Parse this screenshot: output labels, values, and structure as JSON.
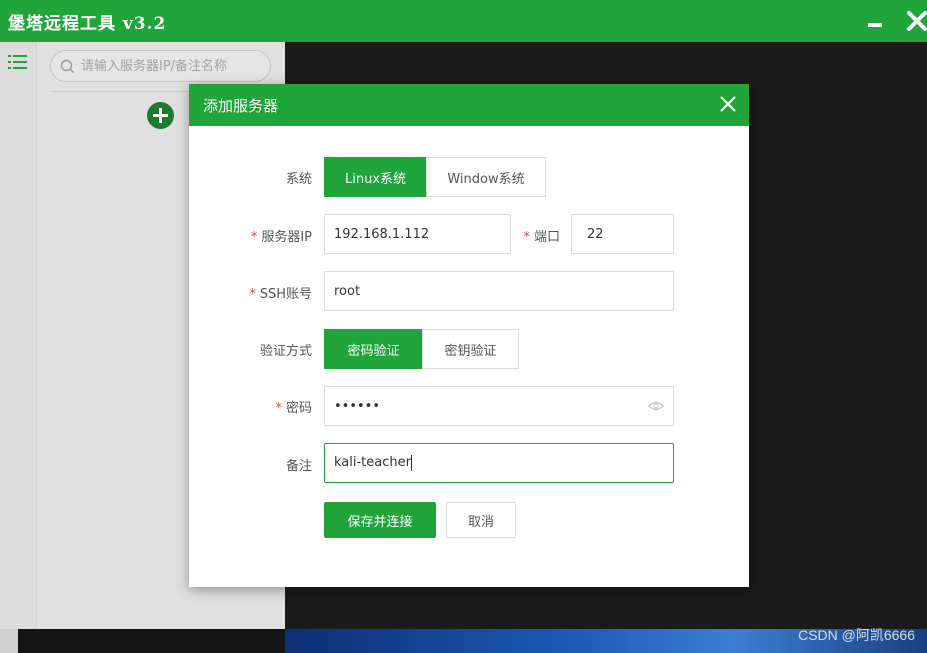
{
  "app": {
    "title": "堡塔远程工具  v3.2",
    "colors": {
      "brand": "#20a53a",
      "dark_bg": "#1b1b1b",
      "panel_bg": "#e0e0e0"
    },
    "icons": {
      "minimize": "minimize-icon",
      "close": "close-icon",
      "list": "list-icon",
      "add": "plus-icon"
    }
  },
  "sidebar": {
    "search": {
      "placeholder": "请输入服务器IP/备注名称"
    }
  },
  "dialog": {
    "title": "添加服务器",
    "system": {
      "label": "系统",
      "options": [
        "Linux系统",
        "Window系统"
      ],
      "selected": "Linux系统"
    },
    "server_ip": {
      "label": "服务器IP",
      "value": "192.168.1.112"
    },
    "port": {
      "label": "端口",
      "value": "22"
    },
    "ssh_account": {
      "label": "SSH账号",
      "value": "root"
    },
    "auth_method": {
      "label": "验证方式",
      "options": [
        "密码验证",
        "密钥验证"
      ],
      "selected": "密码验证"
    },
    "password": {
      "label": "密码",
      "value": "••••••"
    },
    "remark": {
      "label": "备注",
      "value": "kali-teacher"
    },
    "buttons": {
      "save": "保存并连接",
      "cancel": "取消"
    }
  },
  "watermark": "CSDN @阿凯6666"
}
